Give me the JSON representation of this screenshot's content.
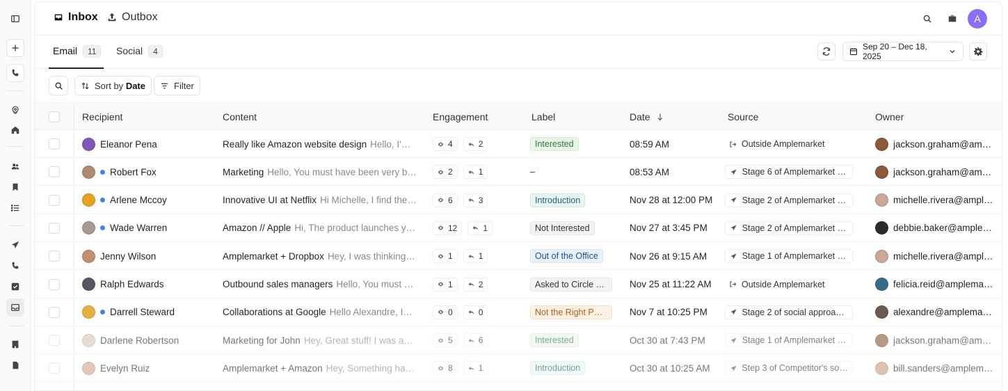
{
  "topbar": {
    "tabs": [
      {
        "label": "Inbox",
        "icon": "inbox-icon",
        "active": true
      },
      {
        "label": "Outbox",
        "icon": "upload-icon",
        "active": false
      }
    ],
    "avatar_initial": "A",
    "avatar_color": "#8b6ff2"
  },
  "subtabs": [
    {
      "label": "Email",
      "count": "11",
      "active": true
    },
    {
      "label": "Social",
      "count": "4",
      "active": false
    }
  ],
  "date_range": "Sep 20 – Dec 18, 2025",
  "toolbar": {
    "sort_prefix": "Sort by",
    "sort_value": "Date",
    "filter_label": "Filter"
  },
  "columns": [
    "Recipient",
    "Content",
    "Engagement",
    "Label",
    "Date",
    "Source",
    "Owner"
  ],
  "rows": [
    {
      "name": "Eleanor Pena",
      "unread": false,
      "subject": "Really like Amazon website design",
      "preview": "Hello, I'm…",
      "opens": "4",
      "replies": "2",
      "label": "Interested",
      "label_style": "green",
      "date": "08:59 AM",
      "source": "Outside Amplemarket",
      "source_type": "outside",
      "owner": "jackson.graham@am…",
      "avatar_color": "#7a5ab8",
      "owner_color": "#8a5a3a",
      "faded": false
    },
    {
      "name": "Robert Fox",
      "unread": true,
      "subject": "Marketing",
      "preview": "Hello, You must have been very bu…",
      "opens": "2",
      "replies": "1",
      "label": "–",
      "label_style": "none",
      "date": "08:53 AM",
      "source": "Stage 6 of Amplemarket a…",
      "source_type": "stage",
      "owner": "jackson.graham@am…",
      "avatar_color": "#b08a70",
      "owner_color": "#8a5a3a",
      "faded": false
    },
    {
      "name": "Arlene Mccoy",
      "unread": true,
      "subject": "Innovative UI at Netflix",
      "preview": "Hi Michelle, I find the…",
      "opens": "6",
      "replies": "3",
      "label": "Introduction",
      "label_style": "teal",
      "date": "Nov 28 at 12:00 PM",
      "source": "Stage 2 of Amplemarket a…",
      "source_type": "stage",
      "owner": "michelle.rivera@ampl…",
      "avatar_color": "#e8a020",
      "owner_color": "#c9a79a",
      "faded": false
    },
    {
      "name": "Wade Warren",
      "unread": true,
      "subject": "Amazon // Apple",
      "preview": "Hi, The product launches your",
      "opens": "12",
      "replies": "1",
      "label": "Not Interested",
      "label_style": "gray",
      "date": "Nov 27 at 3:45 PM",
      "source": "Stage 2 of Amplemarket a…",
      "source_type": "stage",
      "owner": "debbie.baker@ample…",
      "avatar_color": "#a89a90",
      "owner_color": "#2c2c2c",
      "faded": false
    },
    {
      "name": "Jenny Wilson",
      "unread": false,
      "subject": "Amplemarket + Dropbox",
      "preview": "Hey, I was thinking…",
      "opens": "1",
      "replies": "1",
      "label": "Out of the Office",
      "label_style": "blue",
      "date": "Nov 26 at 9:15 AM",
      "source": "Stage 1 of Amplemarket a…",
      "source_type": "stage",
      "owner": "michelle.rivera@ampl…",
      "avatar_color": "#c09070",
      "owner_color": "#c9a79a",
      "faded": false
    },
    {
      "name": "Ralph Edwards",
      "unread": false,
      "subject": "Outbound sales managers",
      "preview": "Hello, You must ha…",
      "opens": "1",
      "replies": "2",
      "label": "Asked to Circle B…",
      "label_style": "gray",
      "date": "Nov 25 at 11:22 AM",
      "source": "Outside Amplemarket",
      "source_type": "outside",
      "owner": "felicia.reid@amplema…",
      "avatar_color": "#55585c",
      "owner_color": "#3a6a8a",
      "faded": false
    },
    {
      "name": "Darrell Steward",
      "unread": true,
      "subject": "Collaborations at Google",
      "preview": "Hello Alexandre, I…",
      "opens": "0",
      "replies": "0",
      "label": "Not the Right Pe…",
      "label_style": "orange",
      "date": "Nov 7 at 10:25 PM",
      "source": "Stage 2 of social approach…",
      "source_type": "stage",
      "owner": "alexandre@amplemar…",
      "avatar_color": "#e8b040",
      "owner_color": "#6a5a50",
      "faded": false
    },
    {
      "name": "Darlene Robertson",
      "unread": false,
      "subject": "Marketing for John",
      "preview": "Hey, Great stuff! I was act…",
      "opens": "5",
      "replies": "6",
      "label": "Interested",
      "label_style": "green",
      "date": "Oct 30 at 7:43 PM",
      "source": "Stage 1 of Amplemarket a…",
      "source_type": "stage",
      "owner": "jackson.graham@am…",
      "avatar_color": "#d8c8b8",
      "owner_color": "#8a5a3a",
      "faded": true
    },
    {
      "name": "Evelyn Ruiz",
      "unread": false,
      "subject": "Amplemarket + Amazon",
      "preview": "Hey, Something has…",
      "opens": "8",
      "replies": "1",
      "label": "Introduction",
      "label_style": "teal",
      "date": "Oct  30 at 10:25 AM",
      "source": "Step 3 of Competitor's soci…",
      "source_type": "stage",
      "owner": "bill.sanders@amplem…",
      "avatar_color": "#d0a890",
      "owner_color": "#c8a080",
      "faded": true
    }
  ],
  "label_colors": {
    "green": {
      "fg": "#2f7a3d",
      "bg": "#eaf6e8",
      "border": "#d6ebd2"
    },
    "teal": {
      "fg": "#1f6a6a",
      "bg": "#e9f5f4",
      "border": "#cfe6e3"
    },
    "gray": {
      "fg": "#333333",
      "bg": "#f4f4f4",
      "border": "#e6e6e6"
    },
    "blue": {
      "fg": "#1d4f9a",
      "bg": "#eaf1fc",
      "border": "#d3e2f7"
    },
    "orange": {
      "fg": "#b0601a",
      "bg": "#fdf1e4",
      "border": "#f3dfc8"
    }
  }
}
